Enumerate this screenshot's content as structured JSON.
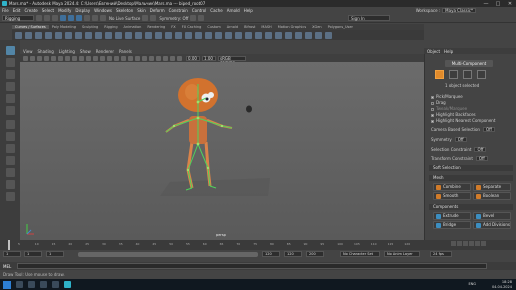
{
  "window": {
    "title": "Mars.ma* - Autodesk Maya 2024.4: C:\\Users\\Евгений\\Desktop\\Мальчик\\Mars.ma --- biped_root07",
    "minimize": "—",
    "maximize": "□",
    "close": "✕"
  },
  "menubar": {
    "items": [
      "File",
      "Edit",
      "Create",
      "Select",
      "Modify",
      "Display",
      "Windows",
      "Skeleton",
      "Skin",
      "Deform",
      "Constrain",
      "Control",
      "Cache",
      "Arnold",
      "Help"
    ],
    "workspace_label": "Workspace :",
    "workspace_value": "Maya Classic*"
  },
  "statusline": {
    "mode": "Rigging",
    "live_surface": "No Live Surface",
    "symmetry": "Symmetry: Off",
    "sign_in": "Sign In"
  },
  "shelf": {
    "tabs": [
      "Curves / Surfaces",
      "Poly Modeling",
      "Sculpting",
      "Rigging",
      "Animation",
      "Rendering",
      "FX",
      "FX Caching",
      "Custom",
      "Arnold",
      "Bifrost",
      "MASH",
      "Motion Graphics",
      "XGen",
      "Polygons_User"
    ]
  },
  "panel": {
    "menus": [
      "View",
      "Shading",
      "Lighting",
      "Show",
      "Renderer",
      "Panels"
    ],
    "near_value": "0.00",
    "far_value": "1.00",
    "camera_space": "sRGB gamma",
    "camera_label": "persp"
  },
  "right_panel": {
    "tabs": [
      "Object",
      "Help"
    ],
    "header": "Multi-Component",
    "selection_info": "1 object selected",
    "pick_marquee": "Pick/Marquee",
    "drag": "Drag",
    "tweak_marquee": "Tweak/Marquee",
    "highlight_backfaces": "Highlight Backfaces",
    "highlight_nearest": "Highlight Nearest Component",
    "camera_based": "Camera Based Selection",
    "camera_based_value": "Off",
    "symmetry": "Symmetry",
    "symmetry_value": "Off",
    "selection_constraint": "Selection Constraint",
    "selection_constraint_value": "Off",
    "transform_constraint": "Transform Constraint",
    "transform_constraint_value": "Off",
    "soft_selection": "Soft Selection",
    "mesh_section": "Mesh",
    "combine": "Combine",
    "separate": "Separate",
    "smooth": "Smooth",
    "boolean": "Boolean",
    "components_section": "Components",
    "extrude": "Extrude",
    "bevel": "Bevel",
    "bridge": "Bridge",
    "add_divisions": "Add Divisions"
  },
  "timeline": {
    "ticks": [
      "5",
      "10",
      "15",
      "20",
      "25",
      "30",
      "35",
      "40",
      "45",
      "50",
      "55",
      "60",
      "65",
      "70",
      "75",
      "80",
      "85",
      "90",
      "95",
      "100",
      "105",
      "110",
      "115",
      "120"
    ],
    "current_frame": "1",
    "start": "1",
    "range_start": "1",
    "range_end": "120",
    "end_120": "120",
    "end_200": "200",
    "character_set": "No Character Set",
    "anim_layer": "No Anim Layer",
    "fps": "24 fps"
  },
  "cmdline": {
    "label": "MEL"
  },
  "helpline": {
    "text": "Draw Tool: Use mouse to draw."
  },
  "taskbar": {
    "lang": "ENG",
    "time": "18:28",
    "date": "04.04.2024"
  }
}
